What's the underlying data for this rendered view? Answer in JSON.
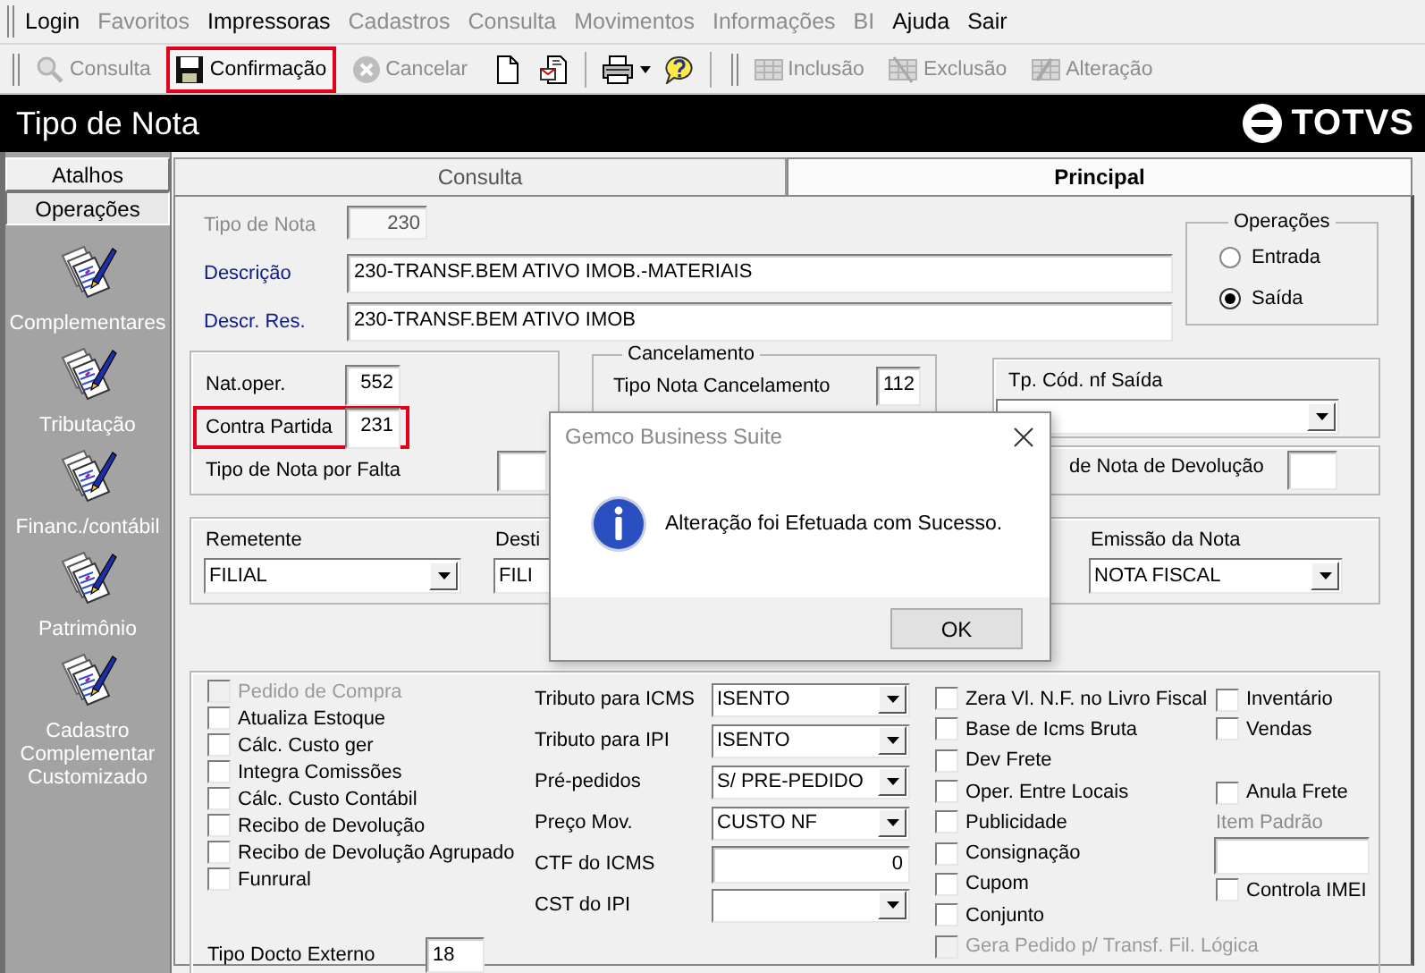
{
  "menu": [
    {
      "label": "Login",
      "disabled": false
    },
    {
      "label": "Favoritos",
      "disabled": true
    },
    {
      "label": "Impressoras",
      "disabled": false
    },
    {
      "label": "Cadastros",
      "disabled": true
    },
    {
      "label": "Consulta",
      "disabled": true
    },
    {
      "label": "Movimentos",
      "disabled": true
    },
    {
      "label": "Informações",
      "disabled": true
    },
    {
      "label": "BI",
      "disabled": true
    },
    {
      "label": "Ajuda",
      "disabled": false
    },
    {
      "label": "Sair",
      "disabled": false
    }
  ],
  "toolbar": [
    {
      "kind": "query",
      "label": "Consulta",
      "disabled": true,
      "highlighted": false
    },
    {
      "kind": "save",
      "label": "Confirmação",
      "disabled": false,
      "highlighted": true
    },
    {
      "kind": "cancel",
      "label": "Cancelar",
      "disabled": true,
      "highlighted": false
    },
    {
      "kind": "new"
    },
    {
      "kind": "export"
    },
    {
      "kind": "separator"
    },
    {
      "kind": "print"
    },
    {
      "kind": "help"
    },
    {
      "kind": "grip"
    },
    {
      "kind": "insert",
      "label": "Inclusão",
      "disabled": true,
      "highlighted": false
    },
    {
      "kind": "delete",
      "label": "Exclusão",
      "disabled": true,
      "highlighted": false
    },
    {
      "kind": "edit",
      "label": "Alteração",
      "disabled": true,
      "highlighted": false
    }
  ],
  "window": {
    "title": "Tipo de Nota",
    "logo": "TOTVS"
  },
  "sidebar": {
    "tabs": [
      {
        "label": "Atalhos",
        "selected": false
      },
      {
        "label": "Operações",
        "selected": true
      }
    ],
    "items": [
      "Complementares",
      "Tributação",
      "Financ./contábil",
      "Patrimônio",
      "Cadastro Complementar Customizado"
    ]
  },
  "tabs": [
    {
      "label": "Consulta",
      "selected": false
    },
    {
      "label": "Principal",
      "selected": true
    }
  ],
  "form": {
    "header_fields": [
      {
        "kind": "code",
        "label": "Tipo de Nota",
        "value": "230",
        "required": false,
        "disabled": true
      },
      {
        "kind": "text",
        "label": "Descrição",
        "value": "230-TRANSF.BEM ATIVO IMOB.-MATERIAIS",
        "required": true,
        "disabled": false
      },
      {
        "kind": "text",
        "label": "Descr. Res.",
        "value": "230-TRANSF.BEM ATIVO IMOB",
        "required": true,
        "disabled": false
      }
    ],
    "operacoes": {
      "title": "Operações",
      "options": [
        {
          "label": "Entrada",
          "selected": false
        },
        {
          "label": "Saída",
          "selected": true
        }
      ]
    },
    "nature": [
      {
        "label": "Nat.oper.",
        "value": "552",
        "highlighted": false
      },
      {
        "label": "Contra Partida",
        "value": "231",
        "highlighted": true
      },
      {
        "label": "Tipo de Nota por Falta",
        "highlighted": false
      }
    ],
    "cancelamento": {
      "title": "Cancelamento",
      "label": "Tipo Nota Cancelamento",
      "value": "112"
    },
    "tp_cod_nf_saida": {
      "label": "Tp. Cód. nf Saída"
    },
    "devolucao": {
      "label": "de Nota de Devolução"
    },
    "parties": [
      {
        "label": "Remetente",
        "value": "FILIAL"
      },
      {
        "label": "Desti",
        "value": "FILI"
      },
      {
        "label": "Emissão da Nota",
        "value": "NOTA FISCAL"
      }
    ],
    "options_left": [
      {
        "label": "Pedido de Compra",
        "checked": false,
        "disabled": true
      },
      {
        "label": "Atualiza Estoque",
        "checked": false,
        "disabled": false
      },
      {
        "label": "Cálc. Custo ger",
        "checked": false,
        "disabled": false
      },
      {
        "label": "Integra Comissões",
        "checked": false,
        "disabled": false
      },
      {
        "label": "Cálc. Custo Contábil",
        "checked": false,
        "disabled": false
      },
      {
        "label": "Recibo de Devolução",
        "checked": false,
        "disabled": false
      },
      {
        "label": "Recibo de Devolução Agrupado",
        "checked": false,
        "disabled": false
      },
      {
        "label": "Funrural",
        "checked": false,
        "disabled": false
      }
    ],
    "tax_fields": [
      {
        "kind": "dropdown",
        "label": "Tributo para ICMS",
        "value": "ISENTO"
      },
      {
        "kind": "dropdown",
        "label": "Tributo para IPI",
        "value": "ISENTO"
      },
      {
        "kind": "dropdown",
        "label": "Pré-pedidos",
        "value": "S/ PRE-PEDIDO"
      },
      {
        "kind": "dropdown",
        "label": "Preço Mov.",
        "value": "CUSTO NF"
      },
      {
        "kind": "number",
        "label": "CTF do ICMS",
        "value": "0"
      },
      {
        "kind": "dropdown",
        "label": "CST do IPI"
      }
    ],
    "options_middle": [
      {
        "label": "Zera Vl. N.F. no Livro Fiscal",
        "checked": false,
        "disabled": false
      },
      {
        "label": "Base de Icms Bruta",
        "checked": false,
        "disabled": false
      },
      {
        "label": "Dev Frete",
        "checked": false,
        "disabled": false
      },
      {
        "label": "Oper. Entre Locais",
        "checked": false,
        "disabled": false
      },
      {
        "label": "Publicidade",
        "checked": false,
        "disabled": false
      },
      {
        "label": "Consignação",
        "checked": false,
        "disabled": false
      },
      {
        "label": "Cupom",
        "checked": false,
        "disabled": false
      },
      {
        "label": "Conjunto",
        "checked": false,
        "disabled": false
      },
      {
        "label": "Gera Pedido p/ Transf. Fil. Lógica",
        "checked": false,
        "disabled": true
      }
    ],
    "options_right": [
      {
        "kind": "checkbox",
        "label": "Inventário",
        "checked": false
      },
      {
        "kind": "checkbox",
        "label": "Vendas",
        "checked": false
      },
      {
        "kind": "checkbox",
        "label": "Anula Frete",
        "checked": false
      },
      {
        "kind": "field",
        "label": "Item Padrão"
      },
      {
        "kind": "checkbox",
        "label": "Controla IMEI",
        "checked": false
      }
    ],
    "external_doc": {
      "label": "Tipo Docto Externo",
      "value": "18"
    }
  },
  "dialog": {
    "title": "Gemco Business Suite",
    "message": "Alteração foi Efetuada com Sucesso.",
    "button": "OK"
  }
}
